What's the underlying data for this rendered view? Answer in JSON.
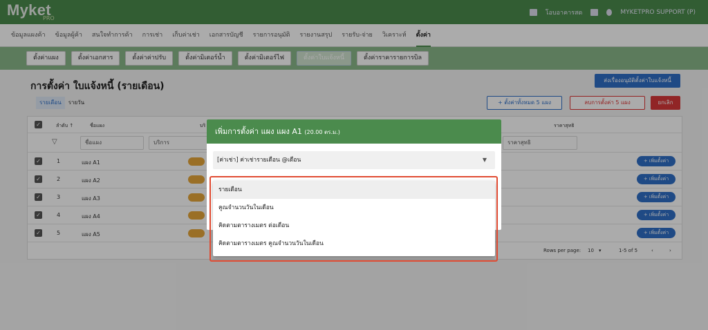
{
  "app": {
    "logo": "Myket",
    "logo_sub": "PRO"
  },
  "topbar": {
    "building": "โอบอาคารสด",
    "user": "MYKETPRO SUPPORT (P)",
    "building_icon": "building-icon",
    "home_icon": "home-icon",
    "user_icon": "user-icon"
  },
  "menu": [
    "ข้อมูลแผงค้า",
    "ข้อมูลผู้ค้า",
    "สนใจทำการค้า",
    "การเช่า",
    "เก็บค่าเช่า",
    "เอกสารบัญชี",
    "รายการอนุมัติ",
    "รายงานสรุป",
    "รายรับ-จ่าย",
    "วิเคราะห์",
    "ตั้งค่า"
  ],
  "subtabs": [
    "ตั้งค่าแผง",
    "ตั้งค่าเอกสาร",
    "ตั้งค่าค่าปรับ",
    "ตั้งค่ามิเตอร์น้ำ",
    "ตั้งค่ามิเตอร์ไฟ",
    "ตั้งค่าใบแจ้งหนี้",
    "ตั้งค่าราคารายการบิล"
  ],
  "page": {
    "title": "การตั้งค่า ใบแจ้งหนี้ (รายเดือน)",
    "send_button": "ส่งเรื่องอนุมัติตั้งค่าใบแจ้งหนี้",
    "tab_monthly": "รายเดือน",
    "tab_daily": "รายวัน",
    "add_all_button": "+ ตั้งค่าทั้งหมด 5 แผง",
    "delete_button": "ลบการตั้งค่า 5 แผง",
    "cancel_button": "ยกเลิก"
  },
  "table": {
    "headers": {
      "no": "ลำดับ ↑",
      "stall": "ชื่อแผง",
      "service": "บริ",
      "net_price": "ราคาสุทธิ"
    },
    "filters": {
      "stall": "ชื่อแผง",
      "service": "บริการ",
      "net_price": "ราคาสุทธิ"
    },
    "rows": [
      {
        "no": "1",
        "stall": "แผง A1",
        "action": "+ เพิ่มตั้งค่า"
      },
      {
        "no": "2",
        "stall": "แผง A2",
        "action": "+ เพิ่มตั้งค่า"
      },
      {
        "no": "3",
        "stall": "แผง A3",
        "action": "+ เพิ่มตั้งค่า"
      },
      {
        "no": "4",
        "stall": "แผง A4",
        "action": "+ เพิ่มตั้งค่า"
      },
      {
        "no": "5",
        "stall": "แผง A5",
        "action": "+ เพิ่มตั้งค่า"
      }
    ],
    "rows_per_page_label": "Rows per page:",
    "rows_per_page": "10",
    "range": "1-5 of 5"
  },
  "modal": {
    "title": "เพิ่มการตั้งค่า แผง แผง A1",
    "subtitle": "(20.00 ตร.ม.)",
    "select_value": "[ค่าเช่า] ค่าเช่ารายเดือน @เดือน"
  },
  "dropdown": [
    "รายเดือน",
    "คูณจำนวนวันในเดือน",
    "คิดตามตารางเมตร ต่อเดือน",
    "คิดตามตารางเมตร คูณจำนวนวันในเดือน"
  ],
  "colors": {
    "brand": "#4b8b4d",
    "primary": "#2f6fc7",
    "danger": "#d9383a",
    "highlight": "#e04a31"
  }
}
